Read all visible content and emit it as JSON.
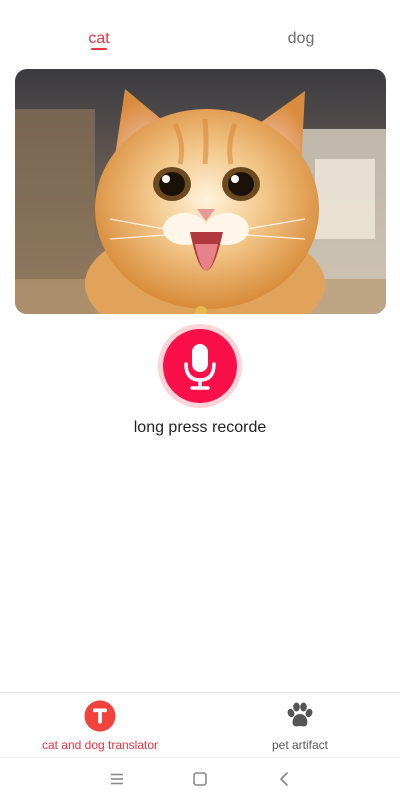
{
  "tabs": [
    {
      "label": "cat",
      "active": true
    },
    {
      "label": "dog",
      "active": false
    }
  ],
  "photo": {
    "subject": "orange kitten with open mouth"
  },
  "record": {
    "label": "long press recorde",
    "icon": "microphone-icon"
  },
  "bottom_nav": [
    {
      "label": "cat and dog translator",
      "icon": "translator-t-icon",
      "active": true
    },
    {
      "label": "pet artifact",
      "icon": "paw-icon",
      "active": false
    }
  ],
  "system_nav": {
    "icons": [
      "menu-icon",
      "home-icon",
      "back-icon"
    ]
  },
  "colors": {
    "accent": "#f0313f",
    "record_button": "#fa0f48",
    "record_ring": "#ffd4d9",
    "inactive_text": "#6d6d6d"
  }
}
